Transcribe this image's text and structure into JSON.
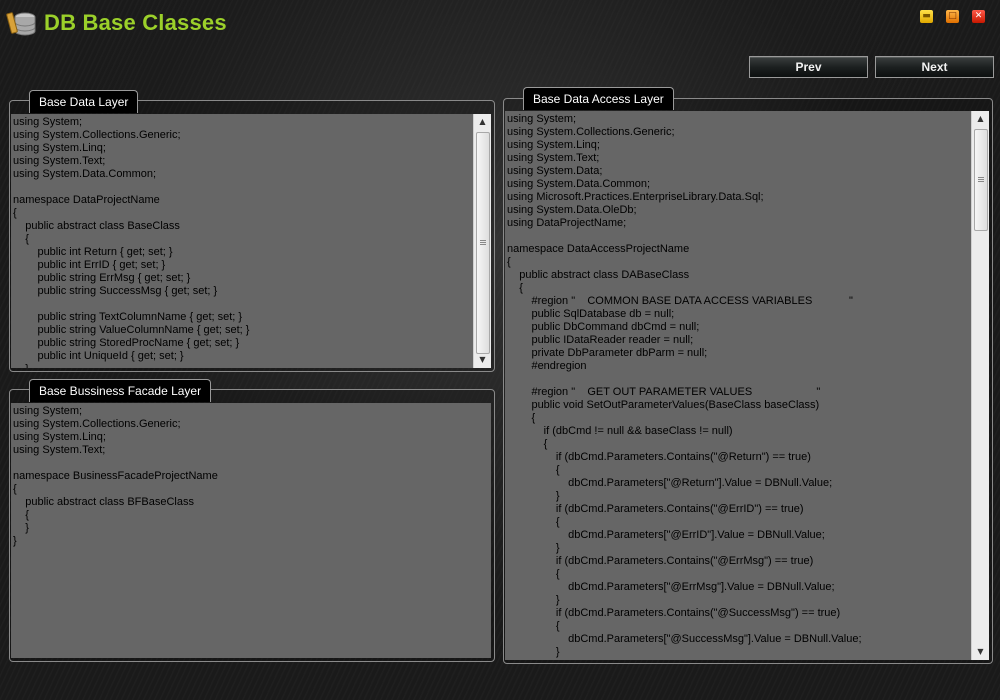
{
  "app": {
    "title": "DB Base Classes",
    "icon": "database-icon"
  },
  "window_controls": {
    "minimize": "minimize-icon",
    "maximize": "maximize-icon",
    "close": "close-icon"
  },
  "nav": {
    "prev_label": "Prev",
    "next_label": "Next"
  },
  "panels": {
    "base_data_layer": {
      "title": "Base Data Layer",
      "code": "using System;\nusing System.Collections.Generic;\nusing System.Linq;\nusing System.Text;\nusing System.Data.Common;\n\nnamespace DataProjectName\n{\n    public abstract class BaseClass\n    {\n        public int Return { get; set; }\n        public int ErrID { get; set; }\n        public string ErrMsg { get; set; }\n        public string SuccessMsg { get; set; }\n\n        public string TextColumnName { get; set; }\n        public string ValueColumnName { get; set; }\n        public string StoredProcName { get; set; }\n        public int UniqueId { get; set; }\n    }"
    },
    "base_business_facade_layer": {
      "title": "Base Bussiness Facade Layer",
      "code": "using System;\nusing System.Collections.Generic;\nusing System.Linq;\nusing System.Text;\n\nnamespace BusinessFacadeProjectName\n{\n    public abstract class BFBaseClass\n    {\n    }\n}"
    },
    "base_data_access_layer": {
      "title": "Base Data Access Layer",
      "code": "using System;\nusing System.Collections.Generic;\nusing System.Linq;\nusing System.Text;\nusing System.Data;\nusing System.Data.Common;\nusing Microsoft.Practices.EnterpriseLibrary.Data.Sql;\nusing System.Data.OleDb;\nusing DataProjectName;\n\nnamespace DataAccessProjectName\n{\n    public abstract class DABaseClass\n    {\n        #region \"    COMMON BASE DATA ACCESS VARIABLES            \"\n        public SqlDatabase db = null;\n        public DbCommand dbCmd = null;\n        public IDataReader reader = null;\n        private DbParameter dbParm = null;\n        #endregion\n\n        #region \"    GET OUT PARAMETER VALUES                     \"\n        public void SetOutParameterValues(BaseClass baseClass)\n        {\n            if (dbCmd != null && baseClass != null)\n            {\n                if (dbCmd.Parameters.Contains(\"@Return\") == true)\n                {\n                    dbCmd.Parameters[\"@Return\"].Value = DBNull.Value;\n                }\n                if (dbCmd.Parameters.Contains(\"@ErrID\") == true)\n                {\n                    dbCmd.Parameters[\"@ErrID\"].Value = DBNull.Value;\n                }\n                if (dbCmd.Parameters.Contains(\"@ErrMsg\") == true)\n                {\n                    dbCmd.Parameters[\"@ErrMsg\"].Value = DBNull.Value;\n                }\n                if (dbCmd.Parameters.Contains(\"@SuccessMsg\") == true)\n                {\n                    dbCmd.Parameters[\"@SuccessMsg\"].Value = DBNull.Value;\n                }\n            }"
    }
  },
  "scrollbar": {
    "up_icon": "arrow-up-icon",
    "down_icon": "arrow-down-icon"
  }
}
